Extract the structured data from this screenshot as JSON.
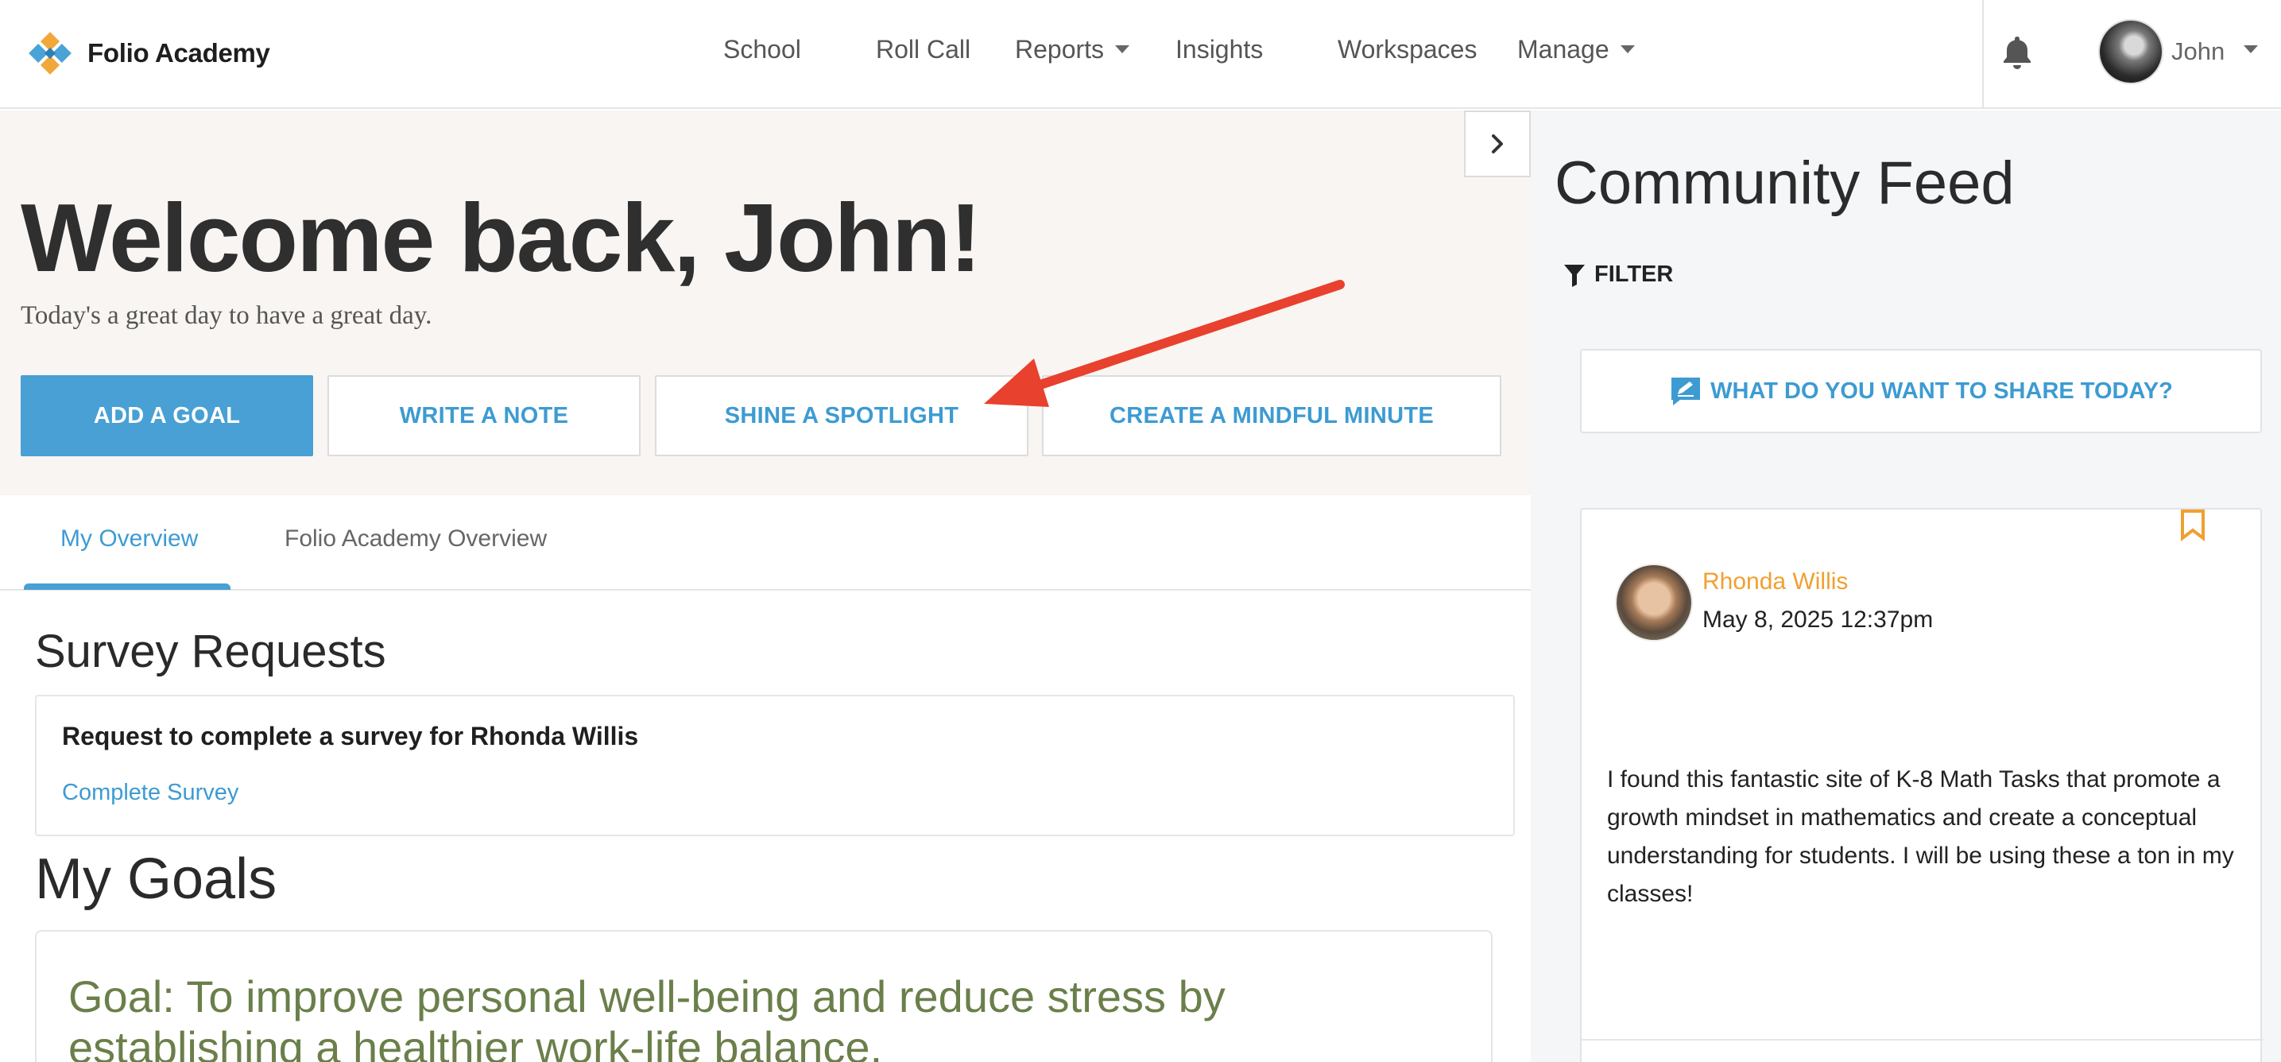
{
  "brand": {
    "name": "Folio Academy",
    "logo_icon": "folio-logo-icon"
  },
  "nav": {
    "items": [
      {
        "label": "School"
      },
      {
        "label": "Roll Call"
      },
      {
        "label": "Reports",
        "dropdown": true
      },
      {
        "label": "Insights"
      },
      {
        "label": "Workspaces"
      },
      {
        "label": "Manage",
        "dropdown": true
      }
    ],
    "notifications_icon": "bell-icon",
    "user": {
      "name": "John"
    }
  },
  "hero": {
    "title": "Welcome back, John!",
    "subtitle": "Today's a great day to have a great day.",
    "buttons": [
      {
        "label": "ADD A GOAL",
        "primary": true
      },
      {
        "label": "WRITE A NOTE"
      },
      {
        "label": "SHINE A SPOTLIGHT"
      },
      {
        "label": "CREATE A MINDFUL MINUTE"
      }
    ]
  },
  "tabs": [
    {
      "label": "My Overview",
      "active": true
    },
    {
      "label": "Folio Academy Overview"
    }
  ],
  "survey": {
    "section_title": "Survey Requests",
    "request_title": "Request to complete a survey for Rhonda Willis",
    "link_label": "Complete Survey"
  },
  "goals": {
    "section_title": "My Goals",
    "goal_text": "Goal: To improve personal well-being and reduce stress by establishing a healthier work-life balance."
  },
  "feed": {
    "title": "Community Feed",
    "filter_label": "FILTER",
    "share_prompt": "WHAT DO YOU WANT TO SHARE TODAY?",
    "post": {
      "author": "Rhonda Willis",
      "date": "May 8, 2025 12:37pm",
      "body": "I found this fantastic site of K-8 Math Tasks that promote a growth mindset in mathematics and create a conceptual understanding for students. I will be using these a ton in my classes!"
    }
  },
  "colors": {
    "accent": "#48a0d4",
    "link": "#3d9bd2",
    "author": "#f0a030",
    "goal": "#6a7f4a",
    "arrow": "#e8412e",
    "hero_bg": "#f8f5f2",
    "feed_bg": "#f5f6f8"
  }
}
